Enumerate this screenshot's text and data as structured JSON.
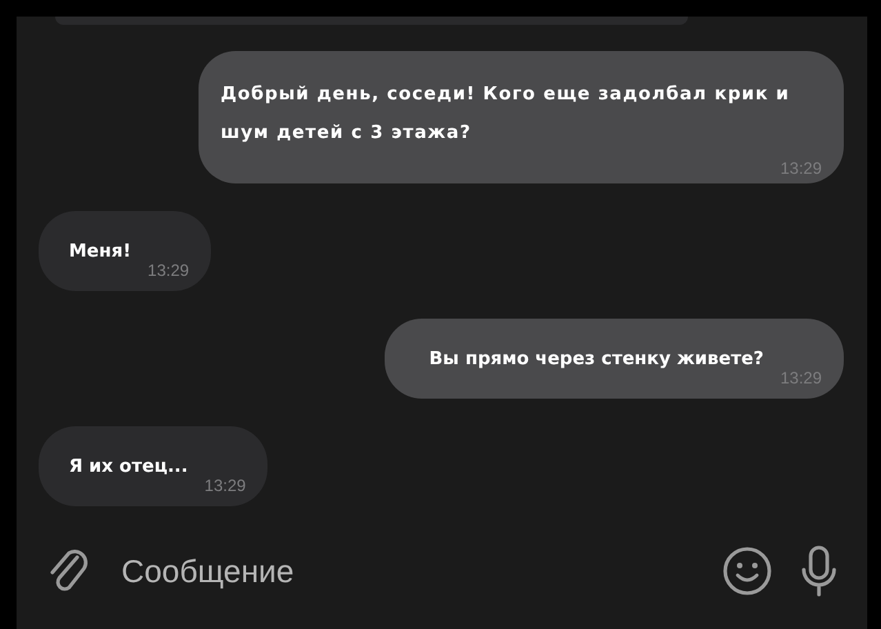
{
  "messages": [
    {
      "kind": "outgoing",
      "text": "Добрый день, соседи! Кого еще задолбал крик и шум детей с 3 этажа?",
      "time": "13:29"
    },
    {
      "kind": "incoming",
      "text": "Меня!",
      "time": "13:29"
    },
    {
      "kind": "outgoing",
      "text": "Вы прямо через стенку живете?",
      "time": "13:29"
    },
    {
      "kind": "incoming",
      "text": "Я их отец...",
      "time": "13:29"
    }
  ],
  "composer": {
    "placeholder": "Сообщение"
  }
}
